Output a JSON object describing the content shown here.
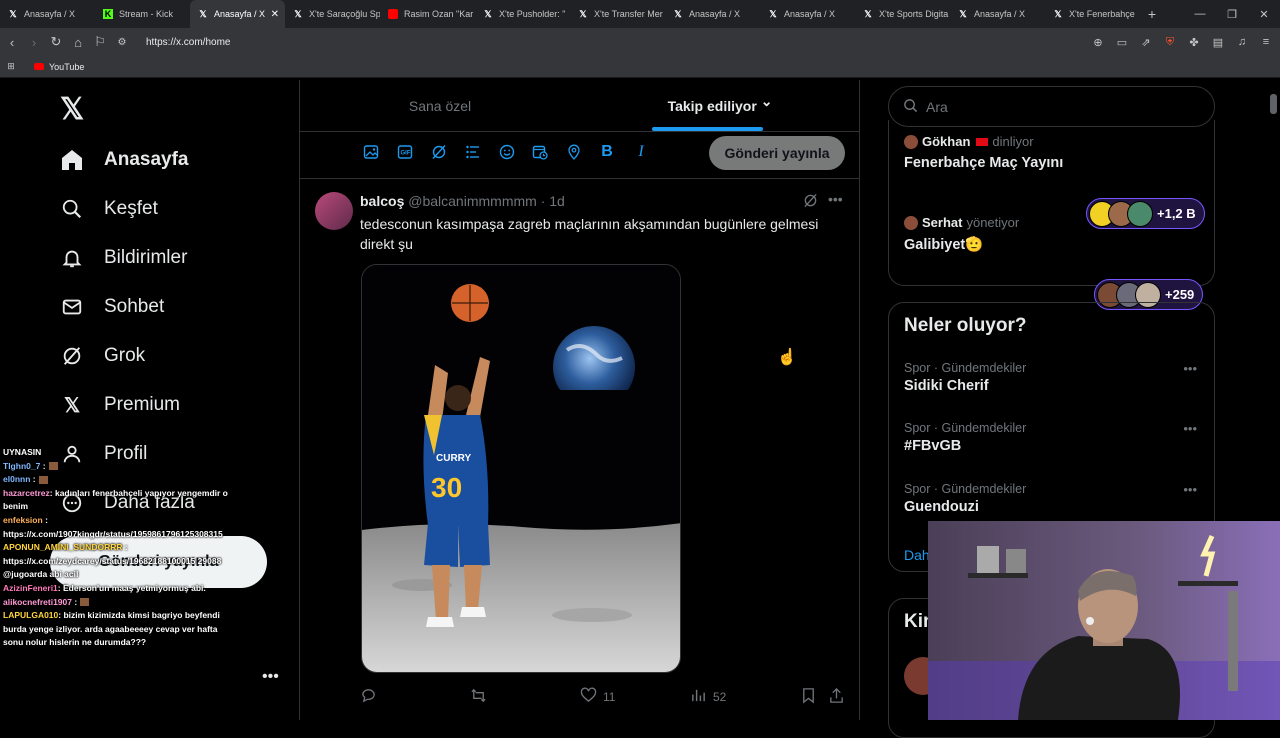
{
  "browser": {
    "tabs": [
      {
        "label": "Anasayfa / X",
        "icon": "x-logo-icon"
      },
      {
        "label": "Stream - Kick",
        "icon": "kick-icon"
      },
      {
        "label": "Anasayfa / X",
        "icon": "x-logo-icon",
        "active": true
      },
      {
        "label": "X'te Saraçoğlu Sp",
        "icon": "x-logo-icon"
      },
      {
        "label": "Rasim Ozan \"Kar",
        "icon": "youtube-icon"
      },
      {
        "label": "X'te Pusholder: \"",
        "icon": "x-logo-icon"
      },
      {
        "label": "X'te Transfer Mer",
        "icon": "x-logo-icon"
      },
      {
        "label": "Anasayfa / X",
        "icon": "x-logo-icon"
      },
      {
        "label": "Anasayfa / X",
        "icon": "x-logo-icon"
      },
      {
        "label": "X'te Sports Digita",
        "icon": "x-logo-icon"
      },
      {
        "label": "Anasayfa / X",
        "icon": "x-logo-icon"
      },
      {
        "label": "X'te Fenerbahçe",
        "icon": "x-logo-icon"
      }
    ],
    "url": "https://x.com/home",
    "bookmark": "YouTube"
  },
  "nav": {
    "items": [
      {
        "label": "Anasayfa",
        "icon": "home-icon"
      },
      {
        "label": "Keşfet",
        "icon": "search-icon"
      },
      {
        "label": "Bildirimler",
        "icon": "bell-icon"
      },
      {
        "label": "Sohbet",
        "icon": "mail-icon"
      },
      {
        "label": "Grok",
        "icon": "grok-icon"
      },
      {
        "label": "Premium",
        "icon": "x-logo-icon"
      },
      {
        "label": "Profil",
        "icon": "person-icon"
      },
      {
        "label": "Daha fazla",
        "icon": "more-circle-icon"
      }
    ],
    "post_button": "Gönderi yayınla",
    "more_dots": "•••"
  },
  "chat": {
    "lines": [
      {
        "text": "UYNASIN",
        "color": "#ffffff"
      },
      {
        "user": "Tlghn0_7",
        "text": ":",
        "color": "#7db6ff"
      },
      {
        "user": "el0nnn",
        "text": ":",
        "color": "#7db6ff"
      },
      {
        "user": "hazarcetrez",
        "text": ": kadınları fenerbahçeli yapıyor yengemdir o benim",
        "color": "#ff9ad5"
      },
      {
        "user": "enfeksion",
        "text": ": https://x.com/1907kingdr/status/1959861796125308315",
        "color": "#ffb15c"
      },
      {
        "user": "APONUN_AMİNI_SUNDORRR",
        "text": ": https://x.com/zeydcarey/status/19682188100015 29088 @jugoarda abi acil",
        "color": "#ffd43b"
      },
      {
        "user": "AzizinFeneri1",
        "text": ": Ederson'un maaş yetmiyormuş abi.",
        "color": "#ff7ab8"
      },
      {
        "user": "alikocnefreti1907",
        "text": ":",
        "color": "#ff9ad5"
      },
      {
        "user": "LAPULGA010",
        "text": ": bizim kizimizda kimsi bagriyo beyfendi burda yenge izliyor. arda agaabeeeey cevap ver hafta sonu nolur hislerin ne durumda???",
        "color": "#ffd43b"
      }
    ]
  },
  "feed": {
    "tabs": [
      "Sana özel",
      "Takip ediliyor"
    ],
    "tab_chevron": "⌄",
    "compose_tools": [
      "image-icon",
      "gif-icon",
      "grok-icon",
      "poll-icon",
      "emoji-icon",
      "schedule-icon",
      "location-icon",
      "bold-icon",
      "italic-icon"
    ],
    "bold_glyph": "B",
    "italic_glyph": "I",
    "compose_button": "Gönderi yayınla",
    "tweet": {
      "name": "balcoş",
      "handle": "@balcanimmmmmm",
      "time": "1d",
      "separator": "·",
      "text": "tedesconun kasımpaşa zagreb maçlarının akşamından bugünlere gelmesi direkt şu",
      "jersey_name": "CURRY",
      "jersey_number": "30",
      "replies": "",
      "retweets": "",
      "likes": "11",
      "views": "52"
    }
  },
  "right": {
    "search_placeholder": "Ara",
    "spaces": [
      {
        "user": "Gökhan",
        "role": "dinliyor",
        "title": "Fenerbahçe Maç Yayını",
        "count": "+1,2 B"
      },
      {
        "user": "Serhat",
        "role": "yönetiyor",
        "title": "Galibiyet🫡",
        "count": "+259"
      }
    ],
    "trends_title": "Neler oluyor?",
    "trends": [
      {
        "category": "Spor · Gündemdekiler",
        "name": "Sidiki Cherif"
      },
      {
        "category": "Spor · Gündemdekiler",
        "name": "#FBvGB"
      },
      {
        "category": "Spor · Gündemdekiler",
        "name": "Guendouzi"
      }
    ],
    "show_more": "Daha fazla göster",
    "who_to_follow": "Kimi takip etmeli"
  },
  "colors": {
    "accent": "#1d9bf0",
    "space_border": "#7856ff",
    "background": "#000000",
    "border": "#2f3336"
  }
}
